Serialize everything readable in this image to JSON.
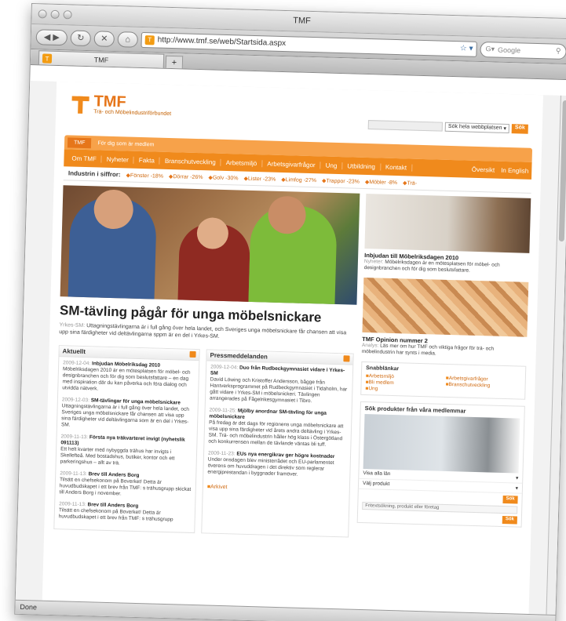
{
  "window": {
    "title": "TMF"
  },
  "toolbar": {
    "url": "http://www.tmf.se/web/Startsida.aspx",
    "search_placeholder": "Google"
  },
  "tabs": [
    {
      "label": "TMF"
    }
  ],
  "status": "Done",
  "site": {
    "logo_name": "TMF",
    "logo_tagline": "Trä- och Möbelindustriförbundet",
    "search": {
      "scope": "Sök hela webbplatsen",
      "button": "Sök"
    },
    "topnav": [
      "TMF",
      "För dig som är medlem"
    ],
    "mainnav": [
      "Om TMF",
      "Nyheter",
      "Fakta",
      "Branschutveckling",
      "Arbetsmiljö",
      "Arbetsgivarfrågor",
      "Ung",
      "Utbildning",
      "Kontakt"
    ],
    "mainnav_right": [
      "Översikt",
      "In English"
    ],
    "stats_label": "Industrin i siffror:",
    "stats": [
      "Fönster -18%",
      "Dörrar -26%",
      "Golv -30%",
      "Lister -23%",
      "Limfog -27%",
      "Trappor -23%",
      "Möbler -8%",
      "Trä-"
    ],
    "hero": {
      "title": "SM-tävling pågår för unga möbelsnickare",
      "tag": "Yrkes-SM:",
      "text": "Uttagningstävlingarna är i full gång över hela landet, och Sveriges unga möbelsnickare får chansen att visa upp sina färdigheter vid deltävlingarna sppm är en del i Yrkes-SM."
    },
    "aktuellt": {
      "title": "Aktuellt",
      "items": [
        {
          "date": "2009-12-04:",
          "title": "Inbjudan Möbelriksdag 2010",
          "text": "Möbelriksdagen 2010 är en mötesplatsen för möbel- och designbranchen och för dig som beslutsfattare – en dag med inspiration där du kan påverka och föra dialog och utvidda nätverk."
        },
        {
          "date": "2009-12-03:",
          "title": "SM-tävlingar för unga möbelsnickare",
          "text": "Uttagningstävlingarna är i full gång över hela landet, och Sveriges unga möbelsnickare får chansen att visa upp sina färdigheter vid deltävlingarna som är en del i Yrkes-SM."
        },
        {
          "date": "2009-11-13:",
          "title": "Första nya träkvarteret invigt (nyhetslik 091113)",
          "text": "Ett helt kvarter med nybyggda trähus har invigts i Skellefteå. Med bostadshus, butiker, kontor och ett parkeringshus – allt av trä."
        },
        {
          "date": "2009-11-13:",
          "title": "Brev till Anders Borg",
          "text": "Tilsätt en chefsekonom på Boverket! Detta är huvudbudskapet i ett brev från TMF: s trähusgrupp skickat till Anders Borg i november."
        },
        {
          "date": "2009-11-13:",
          "title": "Brev till Anders Borg",
          "text": "Tilsätt en chefsekonom på Boverket! Detta är huvudbudskapet i ett brev från TMF: s trähusgrupp"
        }
      ]
    },
    "press": {
      "title": "Pressmeddelanden",
      "items": [
        {
          "date": "2009-12-04:",
          "title": "Duo från Rudbeckgymnasiet vidare i Yrkes-SM",
          "text": "David Löwing och Kristoffer Andersson, bågge från Hantverksprogrammet på Rudbeckgymnasiet i Tidaholm, har gått vidare i Yrkes-SM i möbelsnickeri. Tävlingen arrangerades på Fågelrikesgymnasiet i Tibro."
        },
        {
          "date": "2009-11-25:",
          "title": "Mjölby anordnar SM-tävling för unga möbelsnickare",
          "text": "På fredag är det dags för regionens unga möbelsnickare att visa upp sina färdigheter vid årets andra deltävling i Yrkes-SM. Trä- och möbelindustrin håller hög klass i Östergötland och konkurrensen mellan de tävlande väntas bli tuff."
        },
        {
          "date": "2009-11-23:",
          "title": "EUs nya energikrav ger högre kostnader",
          "text": "Under onsdagen blev ministerrådet och EU-parlamentet överens om huvuddragen i det direktiv som reglerar energiprestandan i byggnader framöver."
        }
      ],
      "archive": "Arkivet"
    },
    "side": [
      {
        "title": "Inbjudan till Möbelriksdagen 2010",
        "tag": "Nyheter:",
        "text": "Möbelriksdagen är en mötesplatsen för möbel- och designbranchen och för dig som beslutsfattare."
      },
      {
        "title": "TMF Opinion nummer 2",
        "tag": "Analys:",
        "text": "Läs mer om hur TMF och viktiga frågor för trä- och möbelindustrin har synts i media."
      }
    ],
    "quicklinks": {
      "title": "Snabblänkar",
      "items": [
        "Arbetsmiljö",
        "Arbetsgivarfrågor",
        "Bli medlem",
        "Branschutveckling",
        "Ung"
      ]
    },
    "products": {
      "title": "Sök produkter från våra medlemmar",
      "select1": "Visa alla län",
      "select2": "Välj produkt",
      "button": "Sök",
      "input_placeholder": "Fritextsökning, produkt eller företag",
      "button2": "Sök"
    }
  }
}
